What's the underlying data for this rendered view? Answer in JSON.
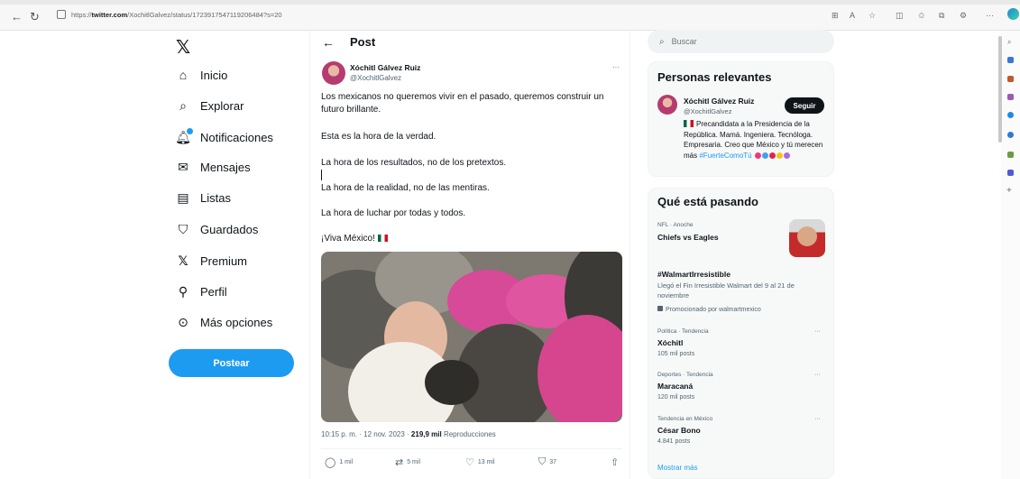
{
  "browser": {
    "url_prefix": "https://",
    "url_domain": "twitter.com",
    "url_path": "/XochitlGalvez/status/1723917547119206484?s=20"
  },
  "nav": {
    "items": [
      {
        "label": "Inicio",
        "icon": "home-icon"
      },
      {
        "label": "Explorar",
        "icon": "search-icon"
      },
      {
        "label": "Notificaciones",
        "icon": "bell-icon"
      },
      {
        "label": "Mensajes",
        "icon": "mail-icon"
      },
      {
        "label": "Listas",
        "icon": "list-icon"
      },
      {
        "label": "Guardados",
        "icon": "bookmark-icon"
      },
      {
        "label": "Premium",
        "icon": "x-icon"
      },
      {
        "label": "Perfil",
        "icon": "person-icon"
      },
      {
        "label": "Más opciones",
        "icon": "more-circle-icon"
      }
    ],
    "post_button": "Postear"
  },
  "post": {
    "header_title": "Post",
    "author_name": "Xóchitl Gálvez Ruiz",
    "author_handle": "@XochitlGalvez",
    "more": "···",
    "lines": [
      "Los mexicanos no queremos vivir en el pasado, queremos construir un futuro brillante.",
      "Esta es la hora de la verdad.",
      "La hora de los resultados, no de los pretextos.",
      "La hora de la realidad, no de las mentiras.",
      "La hora de luchar por todas y todos.",
      "¡Viva México!"
    ],
    "timestamp": "10:15 p. m. · 12 nov. 2023 · ",
    "views_count": "219,9 mil",
    "views_label": " Reproducciones",
    "actions": {
      "replies": "1 mil",
      "reposts": "5 mil",
      "likes": "13 mil",
      "bookmarks": "37"
    }
  },
  "sidebar": {
    "search_placeholder": "Buscar",
    "relevant": {
      "title": "Personas relevantes",
      "name": "Xóchitl Gálvez Ruiz",
      "handle": "@XochitlGalvez",
      "follow_label": "Seguir",
      "bio": "Precandidata a la Presidencia de la República. Mamá. Ingeniera. Tecnóloga. Empresaria. Creo que México y tú merecen más",
      "hashtag": "#FuerteComoTú"
    },
    "trends": {
      "title": "Qué está pasando",
      "items": [
        {
          "meta": "NFL · Anoche",
          "title": "Chiefs vs Eagles"
        },
        {
          "title": "#WalmartIrresistible",
          "desc": "Llegó el Fin Irresistible Walmart del 9 al 21 de noviembre",
          "promo": "Promocionado por walmartmexico"
        },
        {
          "meta": "Política · Tendencia",
          "title": "Xóchitl",
          "sub": "105 mil posts"
        },
        {
          "meta": "Deportes · Tendencia",
          "title": "Maracaná",
          "sub": "120 mil posts"
        },
        {
          "meta": "Tendencia en México",
          "title": "César Bono",
          "sub": "4.841 posts"
        }
      ],
      "dots": "···",
      "show_more": "Mostrar más"
    }
  },
  "colors": {
    "accent": "#1d9bf0",
    "text": "#0f1419",
    "muted": "#536471"
  }
}
